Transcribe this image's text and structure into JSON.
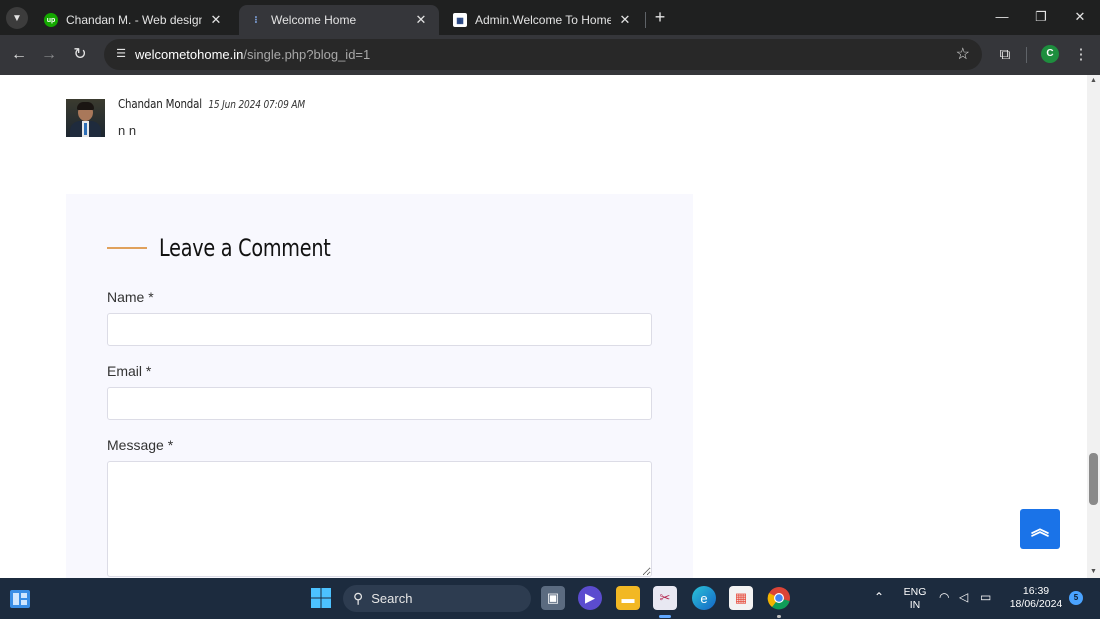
{
  "browser": {
    "tabs": [
      {
        "title": "Chandan M. - Web design - Up",
        "favicon_label": "up",
        "favicon_color": "#14a800",
        "active": false
      },
      {
        "title": "Welcome Home",
        "favicon_label": "",
        "favicon_color": "#35363a",
        "active": true
      },
      {
        "title": "Admin.Welcome To Home",
        "favicon_label": "",
        "favicon_color": "#ffffff",
        "active": false
      }
    ],
    "close_glyph": "✕",
    "new_tab_glyph": "+",
    "url_host": "welcometohome.in",
    "url_path": "/single.php?blog_id=1",
    "profile_initial": "C"
  },
  "comment": {
    "author": "Chandan Mondal",
    "date": "15 Jun 2024 07:09 AM",
    "text": "n n"
  },
  "form": {
    "heading": "Leave a Comment",
    "name_label": "Name *",
    "email_label": "Email *",
    "message_label": "Message *",
    "name_value": "",
    "email_value": "",
    "message_value": ""
  },
  "back_to_top_icon": "double-chevron-up-icon",
  "taskbar": {
    "search_label": "Search",
    "lang_line1": "ENG",
    "lang_line2": "IN",
    "time": "16:39",
    "date": "18/06/2024",
    "notification_count": "5"
  },
  "colors": {
    "accent_line": "#e0a15c",
    "back_to_top": "#1a73e8",
    "form_bg": "#f8f8fe",
    "chrome_dark": "#1f2020",
    "taskbar": "#1c2b3e"
  }
}
